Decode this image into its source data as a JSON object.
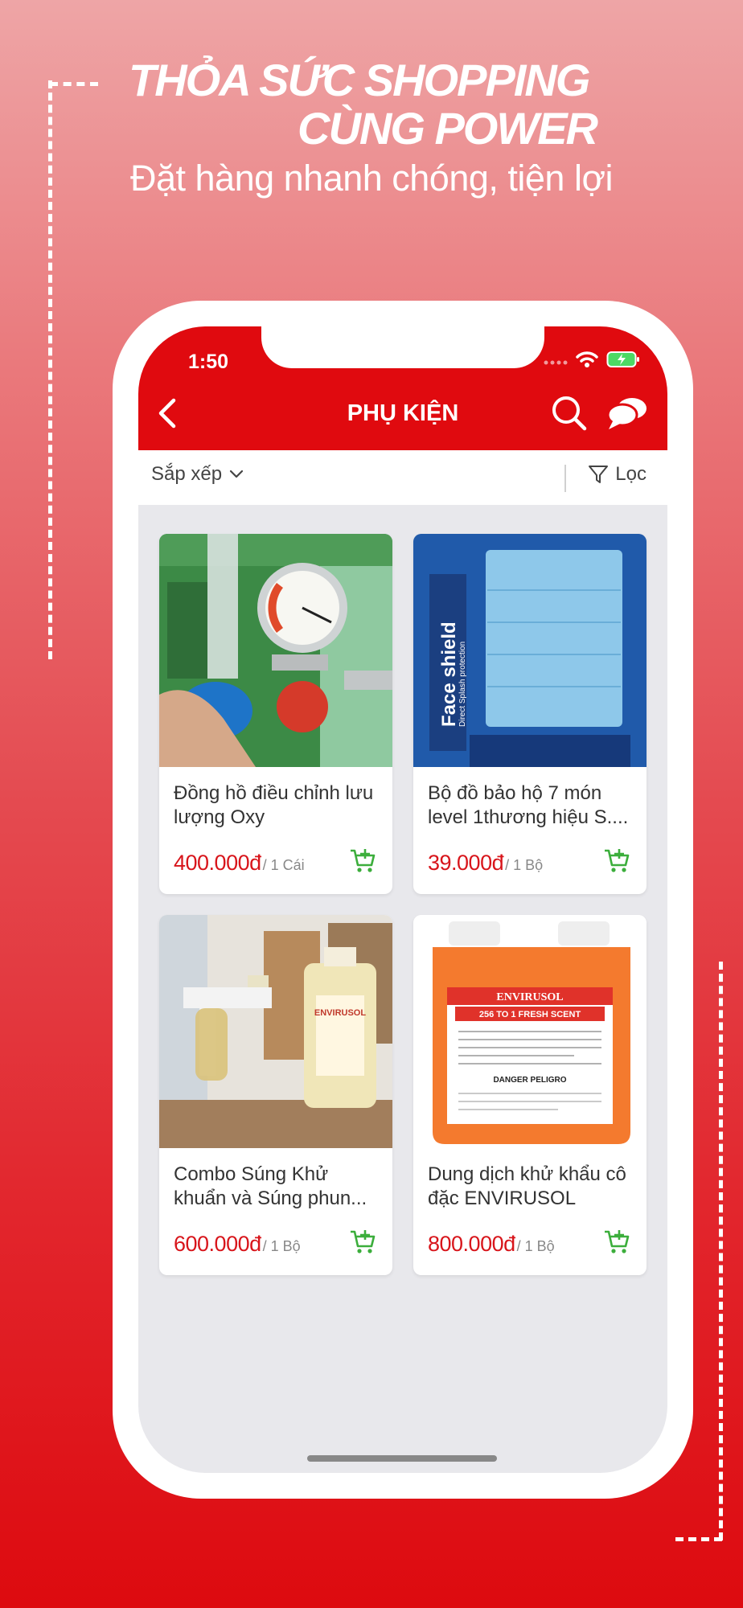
{
  "promo": {
    "headline_line1": "THỎA SỨC SHOPPING",
    "headline_line2": "CÙNG POWER",
    "subline": "Đặt hàng nhanh chóng, tiện lợi"
  },
  "status_bar": {
    "time": "1:50"
  },
  "navbar": {
    "title": "PHỤ KIỆN",
    "back_icon": "chevron-left-icon",
    "search_icon": "search-icon",
    "chat_icon": "chat-icon"
  },
  "toolbar": {
    "sort_label": "Sắp xếp",
    "filter_label": "Lọc"
  },
  "colors": {
    "brand_red": "#e00a0f",
    "price_red": "#d8151b",
    "cart_green": "#3cae3c"
  },
  "products": [
    {
      "name": "Đồng hồ điều chỉnh lưu lượng Oxy",
      "price": "400.000đ",
      "unit": "/ 1 Cái"
    },
    {
      "name": "Bộ đồ bảo hộ 7 món level 1thương hiệu S....",
      "price": "39.000đ",
      "unit": "/ 1 Bộ",
      "image_text": "Face shield",
      "image_subtext": "Direct Splash protection"
    },
    {
      "name": "Combo Súng Khử khuẩn và Súng phun...",
      "price": "600.000đ",
      "unit": "/ 1 Bộ",
      "image_text": "ENVIRUSOL"
    },
    {
      "name": "Dung dịch khử khẩu cô đặc ENVIRUSOL",
      "price": "800.000đ",
      "unit": "/ 1 Bộ",
      "image_text": "ENVIRUSOL",
      "image_subtext": "256 TO 1 FRESH SCENT",
      "image_warning": "DANGER PELIGRO"
    }
  ]
}
